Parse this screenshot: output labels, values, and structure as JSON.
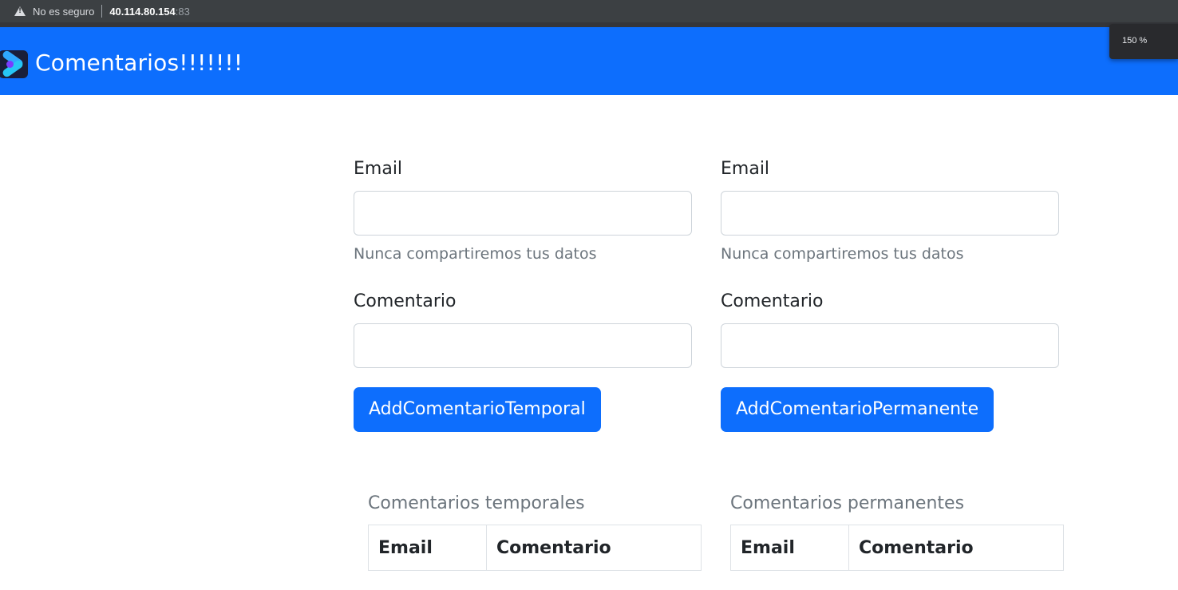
{
  "browser": {
    "security_label": "No es seguro",
    "url_host": "40.114.80.154",
    "url_port": ":83",
    "zoom_text": "150 %"
  },
  "navbar": {
    "title": "Comentarios!!!!!!!"
  },
  "forms": {
    "temporal": {
      "email_label": "Email",
      "email_value": "",
      "email_help": "Nunca compartiremos tus datos",
      "comment_label": "Comentario",
      "comment_value": "",
      "button_label": "AddComentarioTemporal"
    },
    "permanente": {
      "email_label": "Email",
      "email_value": "",
      "email_help": "Nunca compartiremos tus datos",
      "comment_label": "Comentario",
      "comment_value": "",
      "button_label": "AddComentarioPermanente"
    }
  },
  "tables": {
    "temporal": {
      "caption": "Comentarios temporales",
      "columns": [
        "Email",
        "Comentario"
      ]
    },
    "permanente": {
      "caption": "Comentarios permanentes",
      "columns": [
        "Email",
        "Comentario"
      ]
    }
  },
  "colors": {
    "primary": "#0d6efd",
    "muted": "#6c757d",
    "browser_bar": "#3c4043"
  }
}
